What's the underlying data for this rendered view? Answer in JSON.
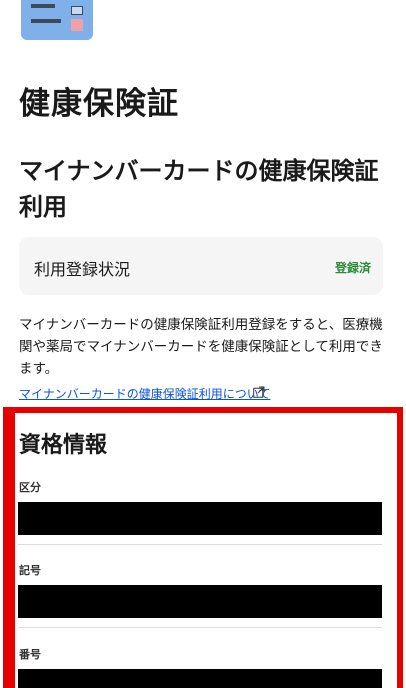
{
  "header": {
    "icon_name": "my-number-card-icon",
    "title": "健康保険証"
  },
  "section": {
    "title": "マイナンバーカードの健康保険証利用"
  },
  "status": {
    "label": "利用登録状況",
    "value": "登録済",
    "value_color": "#2a8a3a"
  },
  "description": "マイナンバーカードの健康保険証利用登録をすると、医療機関や薬局でマイナンバーカードを健康保険証として利用できます。",
  "info_link": {
    "text": "マイナンバーカードの健康保険証利用について",
    "icon_name": "external-link-icon"
  },
  "qualification": {
    "title": "資格情報",
    "fields": [
      {
        "label": "区分"
      },
      {
        "label": "記号"
      },
      {
        "label": "番号"
      }
    ]
  },
  "colors": {
    "highlight_frame": "#e60000",
    "link": "#0b54d6",
    "icon_card": "#7fb0ea"
  }
}
